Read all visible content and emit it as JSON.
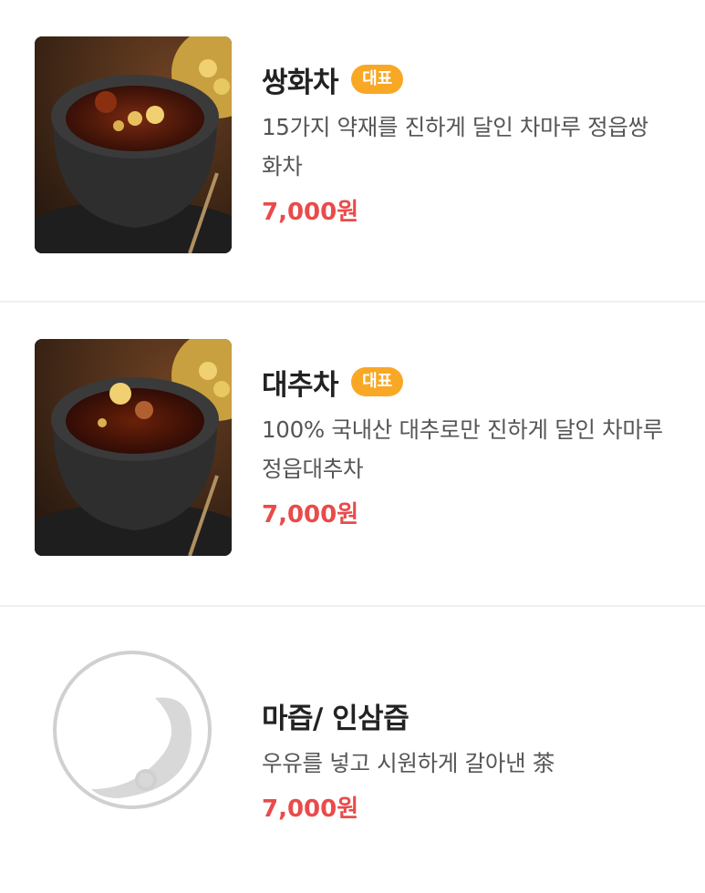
{
  "menu": {
    "items": [
      {
        "name": "쌍화차",
        "badge": "대표",
        "description": "15가지 약재를 진하게 달인 차마루 정읍쌍화차",
        "price": "7,000원",
        "image": "ssanghwa-tea-photo"
      },
      {
        "name": "대추차",
        "badge": "대표",
        "description": "100% 국내산 대추로만 진하게 달인 차마루 정읍대추차",
        "price": "7,000원",
        "image": "jujube-tea-photo"
      },
      {
        "name": "마즙/ 인삼즙",
        "description": "우유를 넣고 시원하게 갈아낸 茶",
        "price": "7,000원",
        "image": "placeholder-logo"
      }
    ]
  },
  "colors": {
    "badge": "#f9a825",
    "price": "#e94b4b",
    "title": "#222222",
    "description": "#555555"
  }
}
